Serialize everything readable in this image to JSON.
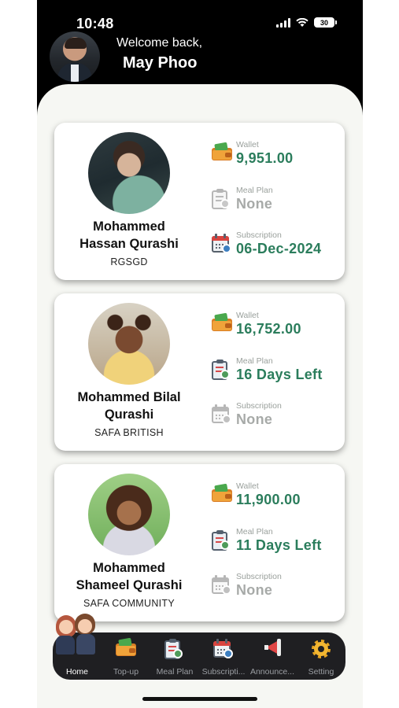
{
  "status_bar": {
    "time": "10:48",
    "battery": "30"
  },
  "header": {
    "welcome": "Welcome back,",
    "username": "May Phoo"
  },
  "children": [
    {
      "name_line1": "Mohammed",
      "name_line2": "Hassan Qurashi",
      "school": "RGSGD",
      "wallet": {
        "label": "Wallet",
        "value": "9,951.00"
      },
      "meal_plan": {
        "label": "Meal Plan",
        "value": "None",
        "active": false
      },
      "subscription": {
        "label": "Subscription",
        "value": "06-Dec-2024",
        "active": true
      }
    },
    {
      "name_line1": "Mohammed Bilal",
      "name_line2": "Qurashi",
      "school": "SAFA BRITISH",
      "wallet": {
        "label": "Wallet",
        "value": "16,752.00"
      },
      "meal_plan": {
        "label": "Meal Plan",
        "value": "16 Days Left",
        "active": true
      },
      "subscription": {
        "label": "Subscription",
        "value": "None",
        "active": false
      }
    },
    {
      "name_line1": "Mohammed",
      "name_line2": "Shameel Qurashi",
      "school": "SAFA COMMUNITY",
      "wallet": {
        "label": "Wallet",
        "value": "11,900.00"
      },
      "meal_plan": {
        "label": "Meal Plan",
        "value": "11 Days Left",
        "active": true
      },
      "subscription": {
        "label": "Subscription",
        "value": "None",
        "active": false
      }
    }
  ],
  "tabs": [
    {
      "label": "Home",
      "icon": "home-icon",
      "active": true
    },
    {
      "label": "Top-up",
      "icon": "wallet-icon",
      "active": false
    },
    {
      "label": "Meal Plan",
      "icon": "meal-plan-icon",
      "active": false
    },
    {
      "label": "Subscripti...",
      "icon": "calendar-icon",
      "active": false
    },
    {
      "label": "Announce...",
      "icon": "megaphone-icon",
      "active": false
    },
    {
      "label": "Setting",
      "icon": "gear-icon",
      "active": false
    }
  ],
  "colors": {
    "accent_green": "#2b7d5c",
    "muted_gray": "#a7aaa8",
    "header_bg": "#000000",
    "tabbar_bg": "#1f1f22"
  }
}
